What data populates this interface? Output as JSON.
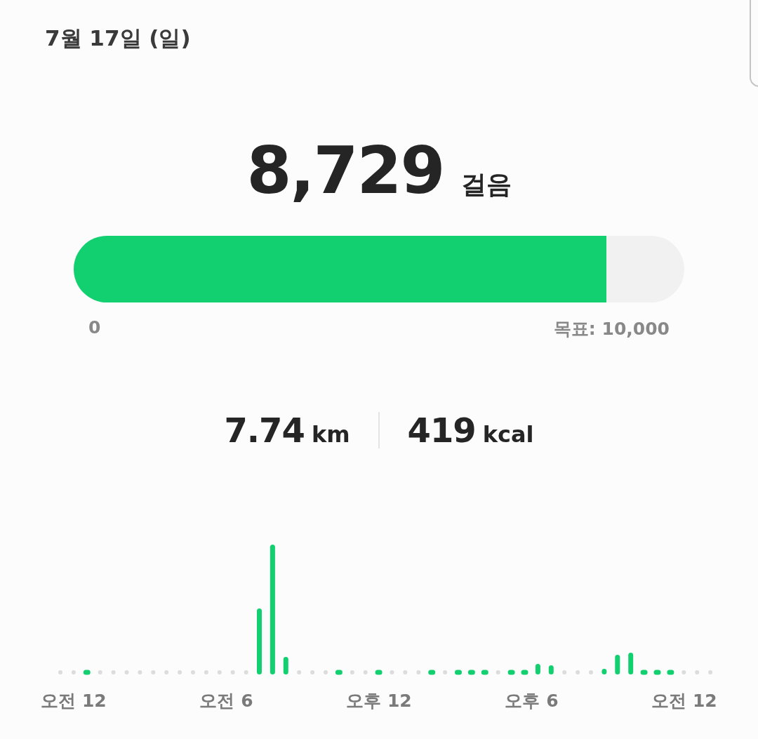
{
  "date": "7월 17일 (일)",
  "steps": {
    "value": "8,729",
    "unit": "걸음"
  },
  "progress": {
    "level": 0.8729,
    "start_label": "0",
    "goal_label": "목표: 10,000"
  },
  "stats": [
    {
      "value": "7.74",
      "unit": "km"
    },
    {
      "value": "419",
      "unit": "kcal"
    }
  ],
  "activity_chart": {
    "x_labels": [
      "오전 12",
      "오전 6",
      "오후 12",
      "오후 6",
      "오전 12"
    ]
  }
}
